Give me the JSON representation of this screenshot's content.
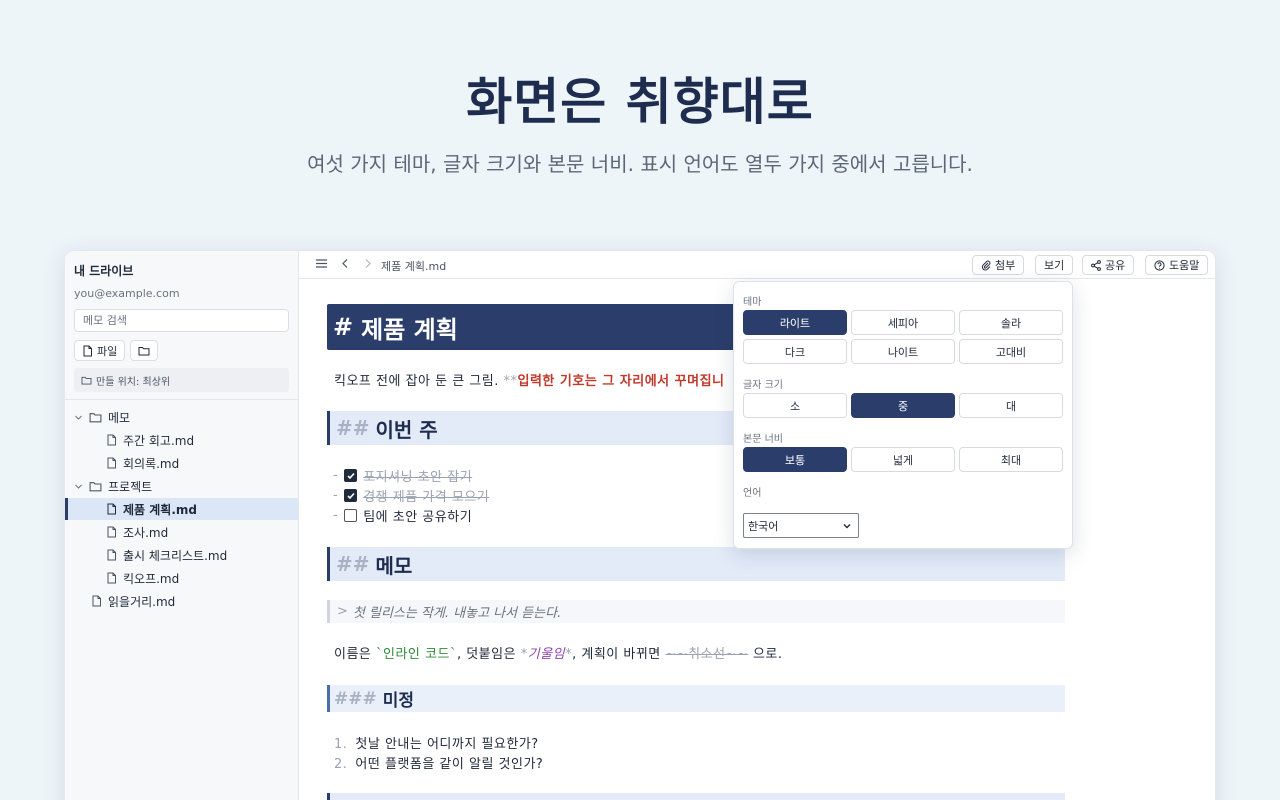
{
  "hero": {
    "title": "화면은 취향대로",
    "subtitle": "여섯 가지 테마, 글자 크기와 본문 너비. 표시 언어도 열두 가지 중에서 고릅니다."
  },
  "sidebar": {
    "title": "내 드라이브",
    "email": "you@example.com",
    "search_placeholder": "메모 검색",
    "file_button": "파일",
    "location": "만들 위치: 최상위",
    "tree": [
      {
        "label": "메모",
        "type": "folder",
        "depth": 0
      },
      {
        "label": "주간 회고.md",
        "type": "file",
        "depth": 1
      },
      {
        "label": "회의록.md",
        "type": "file",
        "depth": 1
      },
      {
        "label": "프로젝트",
        "type": "folder",
        "depth": 0
      },
      {
        "label": "제품 계획.md",
        "type": "file",
        "depth": 1,
        "active": true
      },
      {
        "label": "조사.md",
        "type": "file",
        "depth": 1
      },
      {
        "label": "출시 체크리스트.md",
        "type": "file",
        "depth": 1
      },
      {
        "label": "킥오프.md",
        "type": "file",
        "depth": 1
      },
      {
        "label": "읽을거리.md",
        "type": "file",
        "depth": 0
      }
    ]
  },
  "toolbar": {
    "filename": "제품 계획.md",
    "attach": "첨부",
    "view": "보기",
    "share": "공유",
    "help": "도움말"
  },
  "editor": {
    "h1_mark": "#",
    "h1": "제품 계획",
    "p1_text": "킥오프 전에 잡아 둔 큰 그림. ",
    "p1_mark": "**",
    "p1_bold": "입력한 기호는 그 자리에서 꾸며집니",
    "h2_mark": "##",
    "h2_this_week": "이번 주",
    "tasks": [
      {
        "label": "포지셔닝 초안 잡기",
        "done": true
      },
      {
        "label": "경쟁 제품 가격 모으기",
        "done": true
      },
      {
        "label": "팀에 초안 공유하기",
        "done": false
      }
    ],
    "task_prefix": "-",
    "h2_memo": "메모",
    "quote_mark": ">",
    "quote": "첫 릴리스는 작게. 내놓고 나서 듣는다.",
    "p2_a": "이름은 ",
    "p2_code": "`인라인 코드`",
    "p2_b": ", 덧붙임은 ",
    "p2_italic_mark": "*",
    "p2_italic": "기울임",
    "p2_c": ", 계획이 바뀌면 ",
    "p2_strike": "~~취소선~~",
    "p2_d": " 으로.",
    "h3_mark": "###",
    "h3": "미정",
    "ol": [
      {
        "num": "1.",
        "text": "첫날 안내는 어디까지 필요한가?"
      },
      {
        "num": "2.",
        "text": "어떤 플랫폼을 같이 알릴 것인가?"
      }
    ]
  },
  "settings": {
    "theme_label": "테마",
    "themes": [
      "라이트",
      "세피아",
      "솔라",
      "다크",
      "나이트",
      "고대비"
    ],
    "theme_selected": "라이트",
    "fontsize_label": "글자 크기",
    "fontsizes": [
      "소",
      "중",
      "대"
    ],
    "fontsize_selected": "중",
    "width_label": "본문 너비",
    "widths": [
      "보통",
      "넓게",
      "최대"
    ],
    "width_selected": "보통",
    "language_label": "언어",
    "language_value": "한국어"
  },
  "colors": {
    "accent": "#2b3e6b",
    "heading_bg": "#e3ebf9",
    "bold_red": "#c0392b",
    "code_green": "#2e8b3a",
    "italic_purple": "#8e44ad"
  }
}
